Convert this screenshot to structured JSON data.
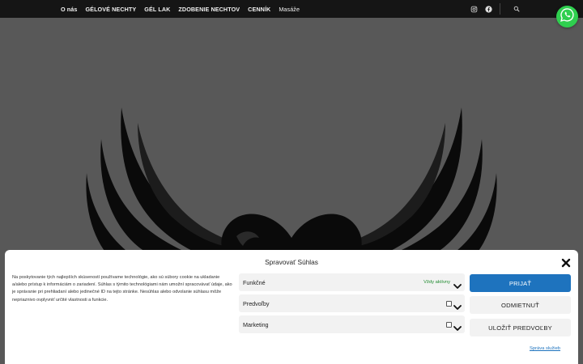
{
  "nav": {
    "items": [
      {
        "label": "O nás",
        "style": "bold"
      },
      {
        "label": "GÉLOVÉ NECHTY",
        "style": "bold"
      },
      {
        "label": "GÉL LAK",
        "style": "bold"
      },
      {
        "label": "ZDOBENIE NECHTOV",
        "style": "bold"
      },
      {
        "label": "CENNÍK",
        "style": "bold"
      },
      {
        "label": "Masáže",
        "style": "light"
      }
    ],
    "icons": [
      "instagram-icon",
      "facebook-icon",
      "search-icon"
    ]
  },
  "whatsapp": {
    "icon": "whatsapp-icon",
    "color": "#2fcf4f"
  },
  "consent": {
    "title": "Spravovať Súhlas",
    "text": "Na poskytovanie tých najlepších skúseností používame technológie, ako sú súbory cookie na ukladanie a/alebo prístup k informáciám o zariadení. Súhlas s týmito technológiami nám umožní spracovávať údaje, ako je správanie pri prehliadaní alebo jedinečné ID na tejto stránke. Nesúhlas alebo odvolanie súhlasu môže nepriaznivo ovplyvniť určité vlastnosti a funkcie.",
    "categories": [
      {
        "label": "Funkčné",
        "status": "Vždy aktívny"
      },
      {
        "label": "Predvoľby",
        "status": ""
      },
      {
        "label": "Marketing",
        "status": ""
      }
    ],
    "buttons": {
      "accept": "PRIJAŤ",
      "deny": "ODMIETNUŤ",
      "save": "ULOŽIŤ PREDVOĽBY"
    },
    "service_link": "Správa služieb"
  },
  "colors": {
    "topbar": "#151515",
    "hero_bg": "#585858",
    "accent": "#1e73be",
    "active_green": "#1e8a2e"
  }
}
